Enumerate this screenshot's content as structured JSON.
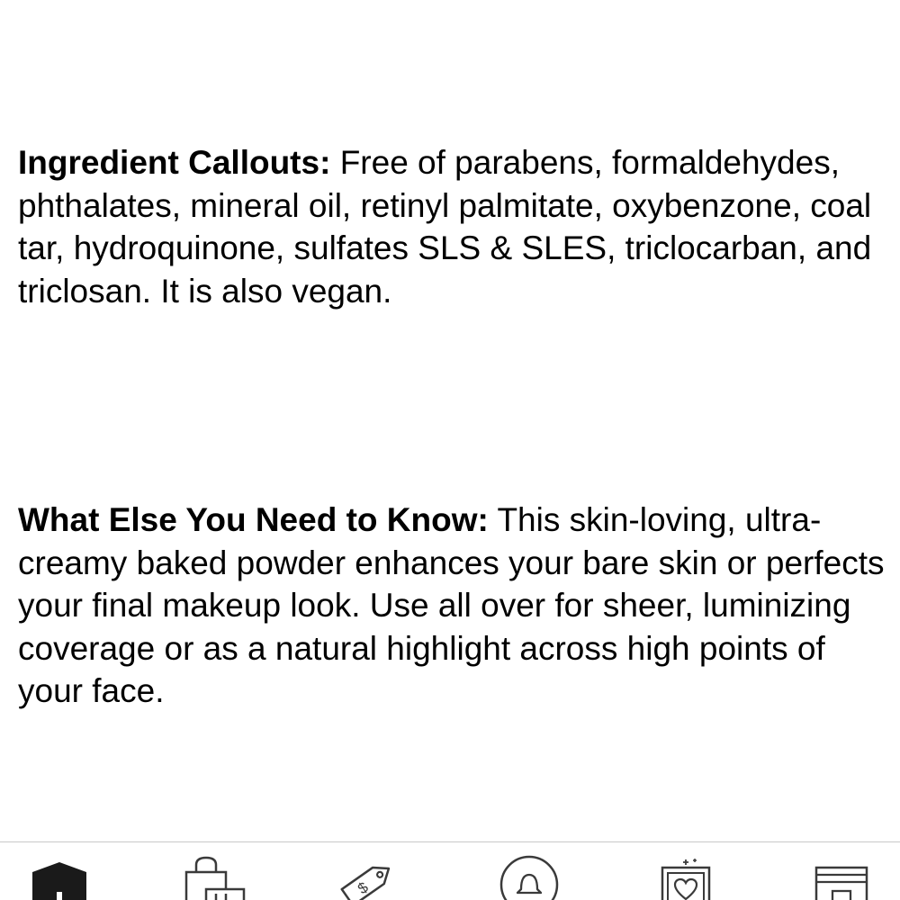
{
  "sections": [
    {
      "heading": "Ingredient Callouts:",
      "body": "Free of parabens, formaldehydes, phthalates, mineral oil, retinyl palmitate, oxybenzone, coal tar, hydroquinone, sulfates SLS & SLES, triclocarban, and triclosan. It is also vegan."
    },
    {
      "heading": "What Else You Need to Know:",
      "body": "This skin-loving, ultra-creamy baked powder enhances your bare skin or perfects your final makeup look. Use all over for sheer, luminizing coverage or as a natural highlight across high points of your face."
    }
  ],
  "tabbar": {
    "tabs": [
      {
        "icon": "home-icon",
        "active": true
      },
      {
        "icon": "shopping-bag-icon",
        "active": false
      },
      {
        "icon": "price-tag-icon",
        "active": false
      },
      {
        "icon": "community-icon",
        "active": false
      },
      {
        "icon": "loves-heart-icon",
        "active": false
      },
      {
        "icon": "store-icon",
        "active": false
      }
    ]
  },
  "colors": {
    "text": "#000000",
    "icon_stroke": "#3a3a3a",
    "divider": "#c8c8c8",
    "active_icon": "#1a1a1a"
  }
}
